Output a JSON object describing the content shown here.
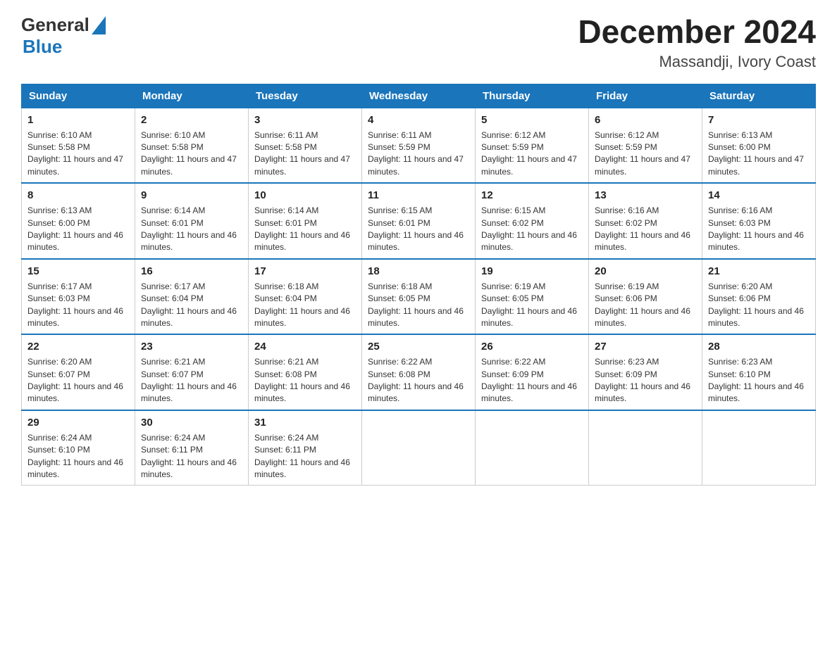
{
  "logo": {
    "line1": "General",
    "triangle_color": "#1a75bb",
    "line2": "Blue"
  },
  "title": {
    "month_year": "December 2024",
    "location": "Massandji, Ivory Coast"
  },
  "headers": [
    "Sunday",
    "Monday",
    "Tuesday",
    "Wednesday",
    "Thursday",
    "Friday",
    "Saturday"
  ],
  "weeks": [
    [
      {
        "day": "1",
        "sunrise": "6:10 AM",
        "sunset": "5:58 PM",
        "daylight": "11 hours and 47 minutes."
      },
      {
        "day": "2",
        "sunrise": "6:10 AM",
        "sunset": "5:58 PM",
        "daylight": "11 hours and 47 minutes."
      },
      {
        "day": "3",
        "sunrise": "6:11 AM",
        "sunset": "5:58 PM",
        "daylight": "11 hours and 47 minutes."
      },
      {
        "day": "4",
        "sunrise": "6:11 AM",
        "sunset": "5:59 PM",
        "daylight": "11 hours and 47 minutes."
      },
      {
        "day": "5",
        "sunrise": "6:12 AM",
        "sunset": "5:59 PM",
        "daylight": "11 hours and 47 minutes."
      },
      {
        "day": "6",
        "sunrise": "6:12 AM",
        "sunset": "5:59 PM",
        "daylight": "11 hours and 47 minutes."
      },
      {
        "day": "7",
        "sunrise": "6:13 AM",
        "sunset": "6:00 PM",
        "daylight": "11 hours and 47 minutes."
      }
    ],
    [
      {
        "day": "8",
        "sunrise": "6:13 AM",
        "sunset": "6:00 PM",
        "daylight": "11 hours and 46 minutes."
      },
      {
        "day": "9",
        "sunrise": "6:14 AM",
        "sunset": "6:01 PM",
        "daylight": "11 hours and 46 minutes."
      },
      {
        "day": "10",
        "sunrise": "6:14 AM",
        "sunset": "6:01 PM",
        "daylight": "11 hours and 46 minutes."
      },
      {
        "day": "11",
        "sunrise": "6:15 AM",
        "sunset": "6:01 PM",
        "daylight": "11 hours and 46 minutes."
      },
      {
        "day": "12",
        "sunrise": "6:15 AM",
        "sunset": "6:02 PM",
        "daylight": "11 hours and 46 minutes."
      },
      {
        "day": "13",
        "sunrise": "6:16 AM",
        "sunset": "6:02 PM",
        "daylight": "11 hours and 46 minutes."
      },
      {
        "day": "14",
        "sunrise": "6:16 AM",
        "sunset": "6:03 PM",
        "daylight": "11 hours and 46 minutes."
      }
    ],
    [
      {
        "day": "15",
        "sunrise": "6:17 AM",
        "sunset": "6:03 PM",
        "daylight": "11 hours and 46 minutes."
      },
      {
        "day": "16",
        "sunrise": "6:17 AM",
        "sunset": "6:04 PM",
        "daylight": "11 hours and 46 minutes."
      },
      {
        "day": "17",
        "sunrise": "6:18 AM",
        "sunset": "6:04 PM",
        "daylight": "11 hours and 46 minutes."
      },
      {
        "day": "18",
        "sunrise": "6:18 AM",
        "sunset": "6:05 PM",
        "daylight": "11 hours and 46 minutes."
      },
      {
        "day": "19",
        "sunrise": "6:19 AM",
        "sunset": "6:05 PM",
        "daylight": "11 hours and 46 minutes."
      },
      {
        "day": "20",
        "sunrise": "6:19 AM",
        "sunset": "6:06 PM",
        "daylight": "11 hours and 46 minutes."
      },
      {
        "day": "21",
        "sunrise": "6:20 AM",
        "sunset": "6:06 PM",
        "daylight": "11 hours and 46 minutes."
      }
    ],
    [
      {
        "day": "22",
        "sunrise": "6:20 AM",
        "sunset": "6:07 PM",
        "daylight": "11 hours and 46 minutes."
      },
      {
        "day": "23",
        "sunrise": "6:21 AM",
        "sunset": "6:07 PM",
        "daylight": "11 hours and 46 minutes."
      },
      {
        "day": "24",
        "sunrise": "6:21 AM",
        "sunset": "6:08 PM",
        "daylight": "11 hours and 46 minutes."
      },
      {
        "day": "25",
        "sunrise": "6:22 AM",
        "sunset": "6:08 PM",
        "daylight": "11 hours and 46 minutes."
      },
      {
        "day": "26",
        "sunrise": "6:22 AM",
        "sunset": "6:09 PM",
        "daylight": "11 hours and 46 minutes."
      },
      {
        "day": "27",
        "sunrise": "6:23 AM",
        "sunset": "6:09 PM",
        "daylight": "11 hours and 46 minutes."
      },
      {
        "day": "28",
        "sunrise": "6:23 AM",
        "sunset": "6:10 PM",
        "daylight": "11 hours and 46 minutes."
      }
    ],
    [
      {
        "day": "29",
        "sunrise": "6:24 AM",
        "sunset": "6:10 PM",
        "daylight": "11 hours and 46 minutes."
      },
      {
        "day": "30",
        "sunrise": "6:24 AM",
        "sunset": "6:11 PM",
        "daylight": "11 hours and 46 minutes."
      },
      {
        "day": "31",
        "sunrise": "6:24 AM",
        "sunset": "6:11 PM",
        "daylight": "11 hours and 46 minutes."
      },
      null,
      null,
      null,
      null
    ]
  ],
  "labels": {
    "sunrise": "Sunrise:",
    "sunset": "Sunset:",
    "daylight": "Daylight:"
  }
}
